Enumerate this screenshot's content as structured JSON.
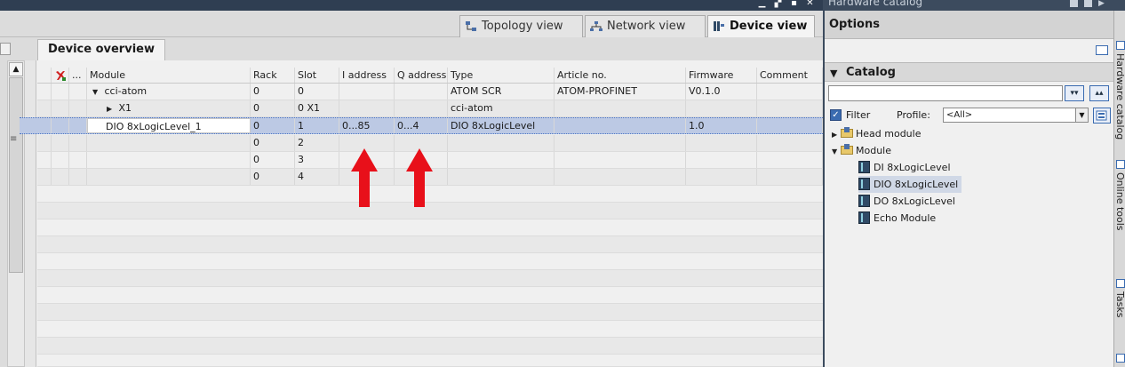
{
  "window": {
    "hardware_catalog_title": "Hardware catalog"
  },
  "view_tabs": [
    {
      "label": "Topology view",
      "icon": "topology-icon",
      "active": false
    },
    {
      "label": "Network view",
      "icon": "network-icon",
      "active": false
    },
    {
      "label": "Device view",
      "icon": "device-icon",
      "active": true
    }
  ],
  "device_overview": {
    "tab_label": "Device overview",
    "columns": [
      "",
      "",
      "...",
      "Module",
      "Rack",
      "Slot",
      "I address",
      "Q address",
      "Type",
      "Article no.",
      "Firmware",
      "Comment"
    ],
    "rows": [
      {
        "expander": "▼",
        "module": "cci-atom",
        "rack": "0",
        "slot": "0",
        "i_address": "",
        "q_address": "",
        "type": "ATOM SCR",
        "article": "ATOM-PROFINET",
        "firmware": "V0.1.0",
        "comment": ""
      },
      {
        "expander": "▶",
        "module": "X1",
        "rack": "0",
        "slot": "0 X1",
        "i_address": "",
        "q_address": "",
        "type": "cci-atom",
        "article": "",
        "firmware": "",
        "comment": ""
      },
      {
        "expander": "",
        "module": "DIO 8xLogicLevel_1",
        "rack": "0",
        "slot": "1",
        "i_address": "0...85",
        "q_address": "0...4",
        "type": "DIO 8xLogicLevel",
        "article": "",
        "firmware": "1.0",
        "comment": ""
      },
      {
        "expander": "",
        "module": "",
        "rack": "0",
        "slot": "2",
        "i_address": "",
        "q_address": "",
        "type": "",
        "article": "",
        "firmware": "",
        "comment": ""
      },
      {
        "expander": "",
        "module": "",
        "rack": "0",
        "slot": "3",
        "i_address": "",
        "q_address": "",
        "type": "",
        "article": "",
        "firmware": "",
        "comment": ""
      },
      {
        "expander": "",
        "module": "",
        "rack": "0",
        "slot": "4",
        "i_address": "",
        "q_address": "",
        "type": "",
        "article": "",
        "firmware": "",
        "comment": ""
      }
    ],
    "selected_row": 2,
    "arrow_color": "#e8101a"
  },
  "options": {
    "title": "Options"
  },
  "catalog": {
    "title": "Catalog",
    "search_value": "",
    "filter_label": "Filter",
    "filter_checked": true,
    "profile_label": "Profile:",
    "profile_value": "<All>",
    "search_btn_down": "▾▾",
    "search_btn_up": "▴▴",
    "tree": [
      {
        "label": "Head module",
        "level": 0,
        "expanded": false,
        "kind": "folder"
      },
      {
        "label": "Module",
        "level": 0,
        "expanded": true,
        "kind": "folder"
      },
      {
        "label": "DI 8xLogicLevel",
        "level": 1,
        "kind": "module"
      },
      {
        "label": "DIO 8xLogicLevel",
        "level": 1,
        "kind": "module",
        "selected": true
      },
      {
        "label": "DO 8xLogicLevel",
        "level": 1,
        "kind": "module"
      },
      {
        "label": "Echo Module",
        "level": 1,
        "kind": "module"
      }
    ]
  },
  "side_tabs": [
    "Hardware catalog",
    "Online tools",
    "Tasks"
  ],
  "colors": {
    "accent": "#3a6bb0",
    "titlebar": "#2f3e52",
    "selection": "#bcc9e4"
  }
}
